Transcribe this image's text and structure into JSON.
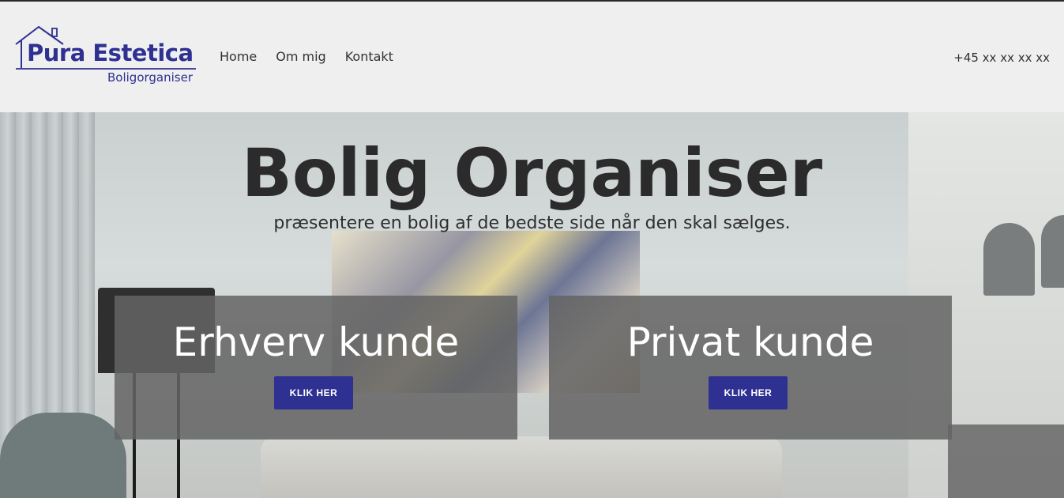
{
  "brand": {
    "name": "Pura Estetica",
    "tagline": "Boligorganiser",
    "color": "#2e3192"
  },
  "nav": {
    "items": [
      {
        "label": "Home"
      },
      {
        "label": "Om mig"
      },
      {
        "label": "Kontakt"
      }
    ]
  },
  "contact": {
    "phone": "+45 xx xx xx xx"
  },
  "hero": {
    "title": "Bolig Organiser",
    "subtitle": "præsentere en bolig af de bedste side når den skal sælges."
  },
  "cards": [
    {
      "title": "Erhverv kunde",
      "button_label": "KLIK HER"
    },
    {
      "title": "Privat kunde",
      "button_label": "KLIK HER"
    }
  ],
  "colors": {
    "header_bg": "#efefef",
    "button_bg": "#2e3192",
    "card_overlay": "#646464"
  }
}
